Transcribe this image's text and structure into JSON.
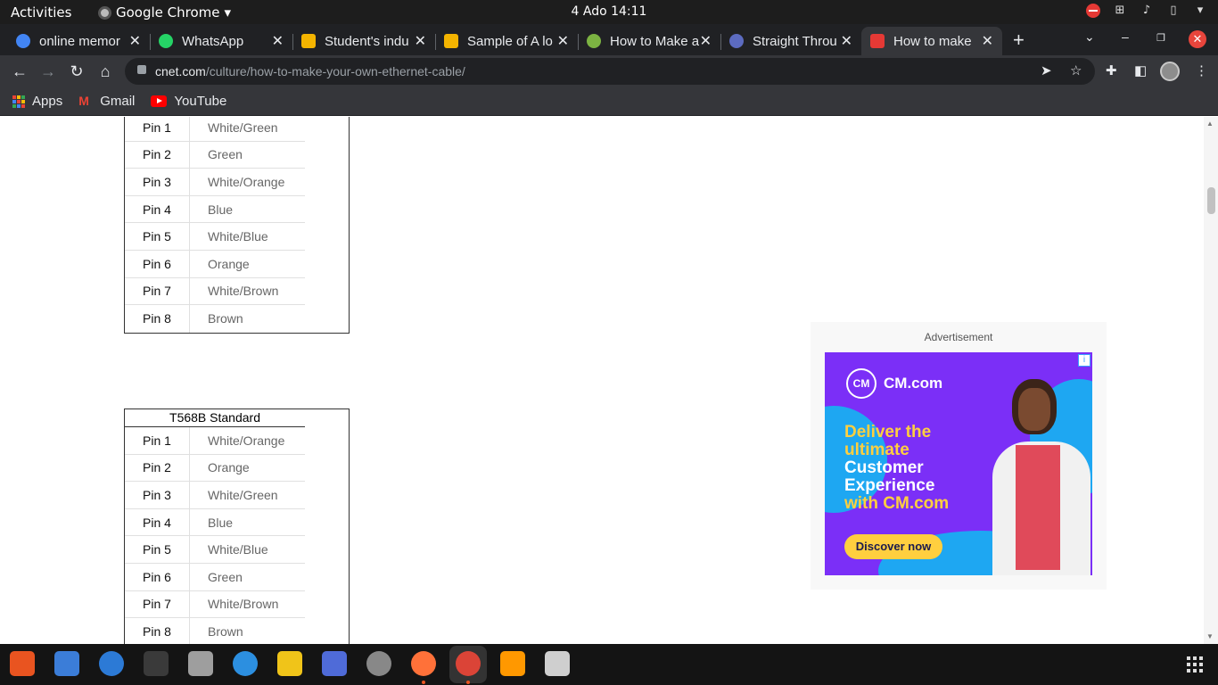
{
  "system_bar": {
    "activities": "Activities",
    "app_name": "Google Chrome",
    "clock": "4 Ado  14:11"
  },
  "tabs": [
    {
      "title": "online memor",
      "favicon": "google-icon",
      "color": "#4285f4"
    },
    {
      "title": "WhatsApp",
      "favicon": "whatsapp-icon",
      "color": "#25d366"
    },
    {
      "title": "Student's indu",
      "favicon": "slides-icon",
      "color": "#f4b400"
    },
    {
      "title": "Sample of A lo",
      "favicon": "slides-icon",
      "color": "#f4b400"
    },
    {
      "title": "How to Make a",
      "favicon": "video-icon",
      "color": "#7cb342"
    },
    {
      "title": "Straight Throu",
      "favicon": "site-icon",
      "color": "#5c6bc0"
    },
    {
      "title": "How to make",
      "favicon": "cnet-icon",
      "color": "#e53935",
      "active": true
    }
  ],
  "toolbar": {
    "url_host": "cnet.com",
    "url_path": "/culture/how-to-make-your-own-ethernet-cable/"
  },
  "bookmarks": [
    {
      "label": "Apps",
      "icon": "apps-grid-icon"
    },
    {
      "label": "Gmail",
      "icon": "gmail-icon"
    },
    {
      "label": "YouTube",
      "icon": "youtube-icon"
    }
  ],
  "table_a": {
    "rows": [
      {
        "pin": "Pin 1",
        "color": "White/Green"
      },
      {
        "pin": "Pin 2",
        "color": "Green"
      },
      {
        "pin": "Pin 3",
        "color": "White/Orange"
      },
      {
        "pin": "Pin 4",
        "color": "Blue"
      },
      {
        "pin": "Pin 5",
        "color": "White/Blue"
      },
      {
        "pin": "Pin 6",
        "color": "Orange"
      },
      {
        "pin": "Pin 7",
        "color": "White/Brown"
      },
      {
        "pin": "Pin 8",
        "color": "Brown"
      }
    ]
  },
  "table_b": {
    "caption": "T568B Standard",
    "rows": [
      {
        "pin": "Pin 1",
        "color": "White/Orange"
      },
      {
        "pin": "Pin 2",
        "color": "Orange"
      },
      {
        "pin": "Pin 3",
        "color": "White/Green"
      },
      {
        "pin": "Pin 4",
        "color": "Blue"
      },
      {
        "pin": "Pin 5",
        "color": "White/Blue"
      },
      {
        "pin": "Pin 6",
        "color": "Green"
      },
      {
        "pin": "Pin 7",
        "color": "White/Brown"
      },
      {
        "pin": "Pin 8",
        "color": "Brown"
      }
    ]
  },
  "ad": {
    "label": "Advertisement",
    "brand": "CM.com",
    "logo_mark": "CM",
    "headline_1": "Deliver the",
    "headline_2": "ultimate",
    "headline_3": "Customer",
    "headline_4": "Experience",
    "headline_5": "with CM.com",
    "cta": "Discover now"
  },
  "dock": [
    {
      "name": "software-center-icon",
      "color": "#e95420"
    },
    {
      "name": "text-editor-icon",
      "color": "#3b7dd8"
    },
    {
      "name": "thunderbird-icon",
      "color": "#2c7ad6"
    },
    {
      "name": "terminal-icon",
      "color": "#3a3a3a"
    },
    {
      "name": "files-icon",
      "color": "#9e9e9e"
    },
    {
      "name": "help-icon",
      "color": "#2c8fe0"
    },
    {
      "name": "rhythmbox-icon",
      "color": "#f0c419"
    },
    {
      "name": "screenshot-icon",
      "color": "#4f6bd8"
    },
    {
      "name": "settings-icon",
      "color": "#888888"
    },
    {
      "name": "firefox-icon",
      "color": "#ff7139"
    },
    {
      "name": "chrome-icon",
      "color": "#db4437"
    },
    {
      "name": "sublime-text-icon",
      "color": "#ff9800"
    },
    {
      "name": "calculator-icon",
      "color": "#cfcfcf"
    }
  ]
}
